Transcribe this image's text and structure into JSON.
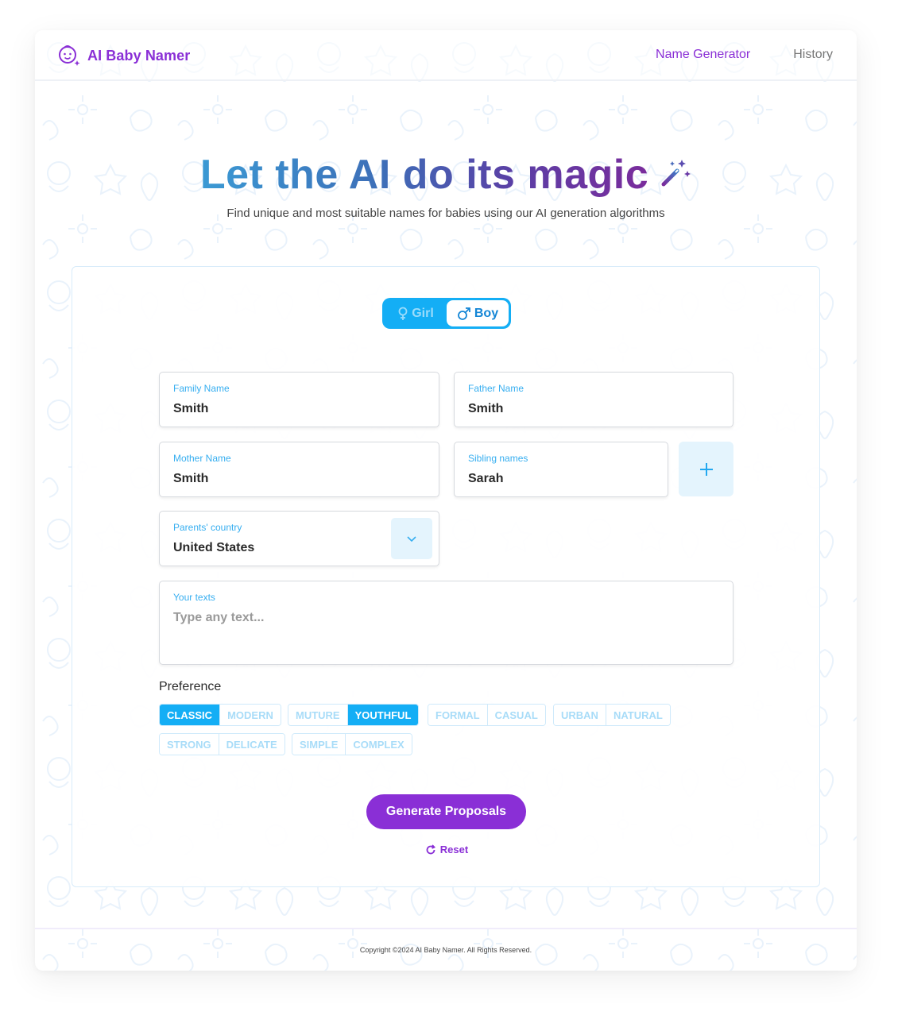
{
  "header": {
    "app_name": "AI Baby Namer",
    "nav": [
      {
        "label": "Name Generator",
        "active": true
      },
      {
        "label": "History",
        "active": false
      }
    ]
  },
  "hero": {
    "title": "Let the AI do its magic",
    "subtitle": "Find unique and most suitable names for babies using our AI generation algorithms"
  },
  "gender": {
    "options": [
      "Girl",
      "Boy"
    ],
    "selected": "Boy"
  },
  "form": {
    "family_name": {
      "label": "Family Name",
      "value": "Smith"
    },
    "father_name": {
      "label": "Father Name",
      "value": "Smith"
    },
    "mother_name": {
      "label": "Mother Name",
      "value": "Smith"
    },
    "sibling_names": {
      "label": "Sibling names",
      "value": "Sarah"
    },
    "country": {
      "label": "Parents' country",
      "value": "United States"
    },
    "texts": {
      "label": "Your texts",
      "placeholder": "Type any text..."
    }
  },
  "preference": {
    "label": "Preference",
    "groups": [
      [
        {
          "label": "CLASSIC",
          "selected": true
        },
        {
          "label": "MODERN",
          "selected": false
        }
      ],
      [
        {
          "label": "MUTURE",
          "selected": false
        },
        {
          "label": "YOUTHFUL",
          "selected": true
        }
      ],
      [
        {
          "label": "FORMAL",
          "selected": false
        },
        {
          "label": "CASUAL",
          "selected": false
        }
      ],
      [
        {
          "label": "URBAN",
          "selected": false
        },
        {
          "label": "NATURAL",
          "selected": false
        }
      ],
      [
        {
          "label": "STRONG",
          "selected": false
        },
        {
          "label": "DELICATE",
          "selected": false
        }
      ],
      [
        {
          "label": "SIMPLE",
          "selected": false
        },
        {
          "label": "COMPLEX",
          "selected": false
        }
      ]
    ]
  },
  "actions": {
    "generate_label": "Generate Proposals",
    "reset_label": "Reset"
  },
  "footer": {
    "copyright": "Copyright ©2024 AI Baby Namer. All Rights Reserved."
  },
  "colors": {
    "brand_purple": "#8a2fd6",
    "accent_blue": "#14aef5",
    "label_blue": "#36aef0"
  }
}
